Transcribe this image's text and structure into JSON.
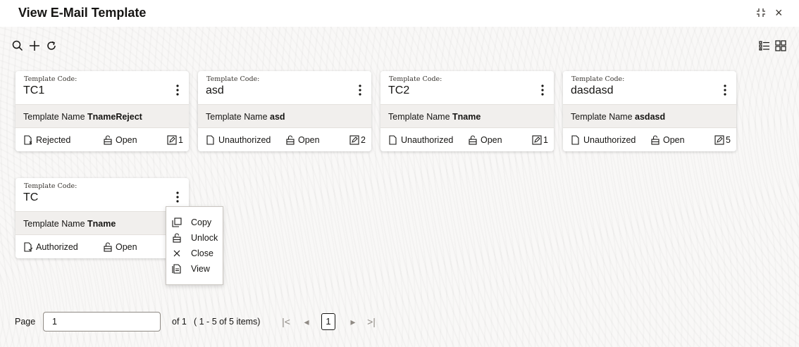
{
  "header": {
    "title": "View E-Mail Template",
    "minimize_icon": "collapse-icon",
    "close_icon": "close-icon",
    "close_glyph": "×"
  },
  "toolbar": {
    "search_icon": "search-icon",
    "add_icon": "add-icon",
    "refresh_icon": "refresh-icon",
    "list_view_icon": "list-view-icon",
    "grid_view_icon": "grid-view-icon"
  },
  "cards": [
    {
      "code_label": "Template Code:",
      "code": "TC1",
      "name_label": "Template Name",
      "name": "TnameReject",
      "status": "Rejected",
      "lock": "Open",
      "mod_count": "1"
    },
    {
      "code_label": "Template Code:",
      "code": "asd",
      "name_label": "Template Name",
      "name": "asd",
      "status": "Unauthorized",
      "lock": "Open",
      "mod_count": "2"
    },
    {
      "code_label": "Template Code:",
      "code": "TC2",
      "name_label": "Template Name",
      "name": "Tname",
      "status": "Unauthorized",
      "lock": "Open",
      "mod_count": "1"
    },
    {
      "code_label": "Template Code:",
      "code": "dasdasd",
      "name_label": "Template Name",
      "name": "asdasd",
      "status": "Unauthorized",
      "lock": "Open",
      "mod_count": "5"
    },
    {
      "code_label": "Template Code:",
      "code": "TC",
      "name_label": "Template Name",
      "name": "Tname",
      "status": "Authorized",
      "lock": "Open",
      "mod_count": ""
    }
  ],
  "context_menu": {
    "items": [
      {
        "label": "Copy",
        "icon": "copy-icon"
      },
      {
        "label": "Unlock",
        "icon": "unlock-icon"
      },
      {
        "label": "Close",
        "icon": "close-icon"
      },
      {
        "label": "View",
        "icon": "view-icon"
      }
    ]
  },
  "pagination": {
    "page_label": "Page",
    "page_value": "1",
    "of_label": "of 1",
    "items_label": "( 1 - 5 of 5 items)",
    "current_page": "1",
    "first_glyph": "|<",
    "prev_glyph": "◂",
    "next_glyph": "▸",
    "last_glyph": ">|"
  },
  "colors": {
    "text": "#161513",
    "card_mid_bg": "#f1efed",
    "page_bg": "#f9f8f7"
  }
}
